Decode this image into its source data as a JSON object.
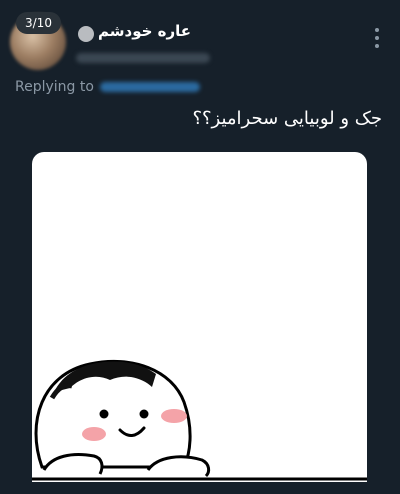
{
  "thread": {
    "counter": "3/10"
  },
  "author": {
    "display_name": "عاره خودشم"
  },
  "reply": {
    "prefix": "Replying to"
  },
  "tweet": {
    "text": "جک و لوبیایی سحرامیز؟؟"
  },
  "media": {
    "description_icon": "cartoon-character"
  }
}
